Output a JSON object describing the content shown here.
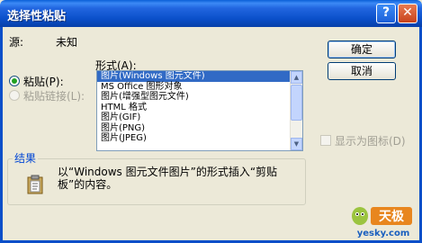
{
  "dialog": {
    "title": "选择性粘贴",
    "help_label": "?",
    "close_label": "✕"
  },
  "source": {
    "label": "源:",
    "value": "未知"
  },
  "buttons": {
    "ok": "确定",
    "cancel": "取消"
  },
  "options": {
    "paste": "粘贴(P):",
    "paste_link": "粘贴链接(L):"
  },
  "format": {
    "label": "形式(A):",
    "items": [
      "图片(Windows 图元文件)",
      "MS Office 图形对象",
      "图片(增强型图元文件)",
      "HTML 格式",
      "图片(GIF)",
      "图片(PNG)",
      "图片(JPEG)"
    ]
  },
  "display_as_icon": "显示为图标(D)",
  "result": {
    "label": "结果",
    "text_line1": "以“Windows 图元文件图片”的形式插入“剪贴",
    "text_line2": "板”的内容。"
  },
  "watermark": {
    "brand": "天极",
    "site": "yesky.com"
  },
  "colors": {
    "title_bar": "#0a4fc9",
    "selection": "#316ac5",
    "radio_dot": "#21a121",
    "group_label": "#0046d5"
  }
}
